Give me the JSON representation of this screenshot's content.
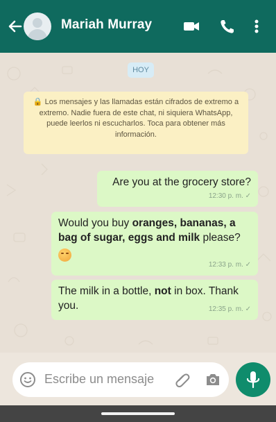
{
  "header": {
    "contact_name": "Mariah Murray",
    "background_color": "#0f6a5e",
    "icons": [
      "back-arrow-icon",
      "avatar",
      "video-call-icon",
      "phone-icon",
      "more-options-icon"
    ]
  },
  "chat": {
    "date_chip": "HOY",
    "notice": "🔒 Los mensajes y las llamadas están cifrados de extremo a extremo. Nadie fuera de este chat, ni siquiera WhatsApp, puede leerlos ni escucharlos. Toca para obtener más información.",
    "messages": [
      {
        "text": "Are you at the grocery store?",
        "time": "12:30 p. m. ✓"
      },
      {
        "text_parts": [
          "Would you buy ",
          "oranges, bananas, a bag of sugar, eggs and milk",
          " please?"
        ],
        "emoji": "😳",
        "time": "12:33 p. m. ✓"
      },
      {
        "text_parts": [
          "The milk in a bottle, ",
          "not",
          " in box. Thank you."
        ],
        "time": "12:35 p. m. ✓"
      }
    ],
    "bubble_color": "#dcf8c6"
  },
  "composer": {
    "placeholder": "Escribe un mensaje",
    "icons": [
      "emoji-icon",
      "attach-icon",
      "camera-icon",
      "mic-icon"
    ],
    "accent_color": "#0f8c6c"
  }
}
